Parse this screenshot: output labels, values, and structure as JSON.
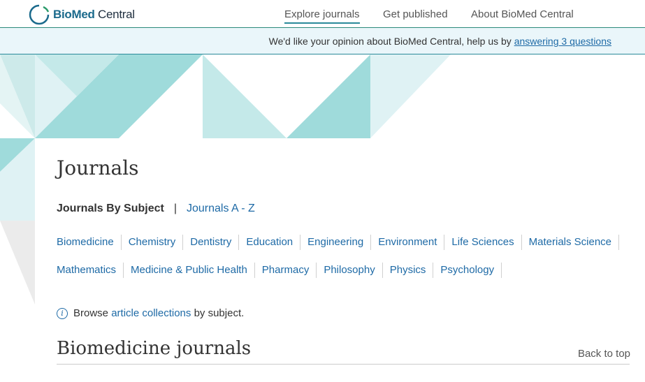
{
  "header": {
    "logo": {
      "bio_med": "BioMed",
      "central": "Central"
    },
    "nav": [
      {
        "label": "Explore journals",
        "active": true
      },
      {
        "label": "Get published",
        "active": false
      },
      {
        "label": "About BioMed Central",
        "active": false
      }
    ]
  },
  "banner": {
    "text": "We'd like your opinion about BioMed Central, help us by ",
    "link": "answering 3 questions"
  },
  "main": {
    "title": "Journals",
    "subnav": {
      "current": "Journals By Subject",
      "separator": "|",
      "other": "Journals A - Z"
    },
    "subjects_row1": [
      "Biomedicine",
      "Chemistry",
      "Dentistry",
      "Education",
      "Engineering",
      "Environment",
      "Life Sciences",
      "Materials Science"
    ],
    "subjects_row2": [
      "Mathematics",
      "Medicine & Public Health",
      "Pharmacy",
      "Philosophy",
      "Physics",
      "Psychology"
    ],
    "browse": {
      "icon": "i",
      "prefix": "Browse ",
      "link": "article collections",
      "suffix": " by subject."
    },
    "section_title": "Biomedicine journals",
    "back_to_top": "Back to top"
  },
  "colors": {
    "accent": "#1e6aa6",
    "teal": "#2a8a9a",
    "banner_bg": "#eaf6fa"
  }
}
